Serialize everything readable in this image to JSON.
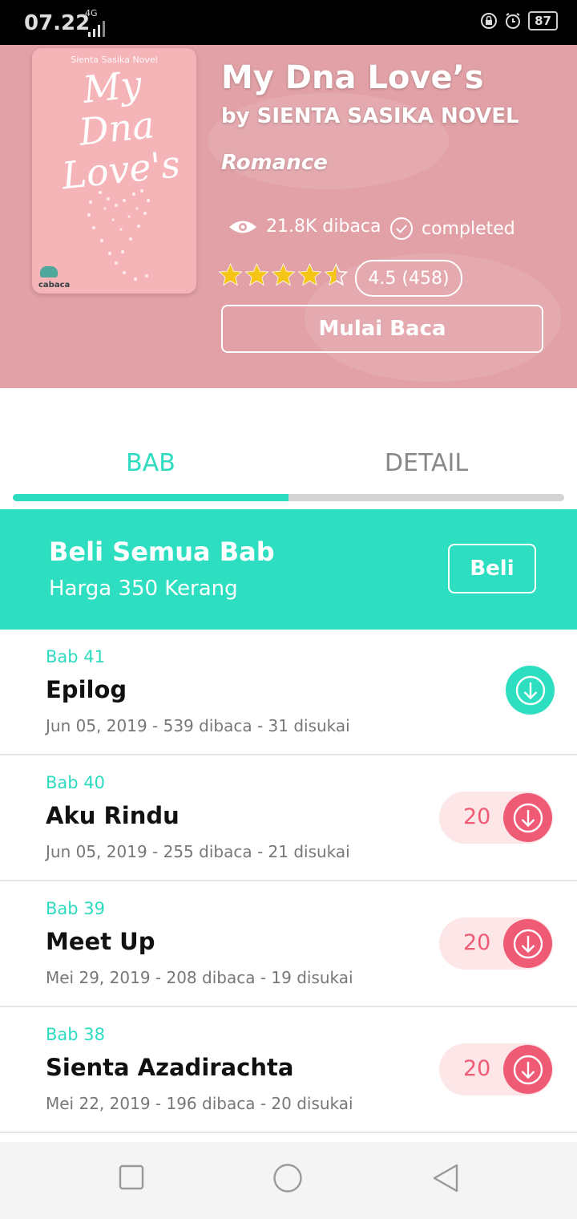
{
  "status_bar": {
    "time": "07.22",
    "network": "4G",
    "battery": "87"
  },
  "book": {
    "title": "My Dna Love’s",
    "author": "by SIENTA SASIKA NOVEL",
    "genre": "Romance",
    "reads": "21.8K dibaca",
    "status": "completed",
    "rating": 4.5,
    "rating_text": "4.5 (458)",
    "read_button": "Mulai Baca",
    "cover": {
      "author": "Sienta Sasika Novel",
      "title_line1": "My Dna",
      "title_line2": "Love's",
      "brand": "cabaca"
    }
  },
  "tabs": [
    {
      "label": "BAB",
      "active": true
    },
    {
      "label": "DETAIL",
      "active": false
    }
  ],
  "buy_all": {
    "title": "Beli Semua Bab",
    "price": "Harga 350 Kerang",
    "button": "Beli"
  },
  "chapters": [
    {
      "number": "Bab 41",
      "title": "Epilog",
      "meta": "Jun 05, 2019 - 539 dibaca - 31 disukai",
      "price": null
    },
    {
      "number": "Bab 40",
      "title": "Aku Rindu",
      "meta": "Jun 05, 2019 - 255 dibaca - 21 disukai",
      "price": "20"
    },
    {
      "number": "Bab 39",
      "title": "Meet Up",
      "meta": "Mei 29, 2019 - 208 dibaca - 19 disukai",
      "price": "20"
    },
    {
      "number": "Bab 38",
      "title": "Sienta Azadirachta",
      "meta": "Mei 22, 2019 - 196 dibaca - 20 disukai",
      "price": "20"
    }
  ],
  "colors": {
    "accent": "#2ddfc0",
    "hero": "#e1a1a6",
    "price": "#ef5a74",
    "price_bg": "#fce6e8",
    "star": "#f5c518"
  }
}
